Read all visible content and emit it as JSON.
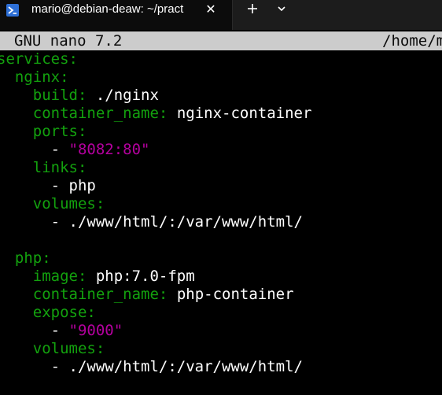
{
  "tab": {
    "title": "mario@debian-deaw: ~/pract",
    "close_label": "✕",
    "new_tab_label": "+",
    "dropdown_label": "⌄"
  },
  "nano": {
    "version": "GNU nano 7.2",
    "path": "/home/m"
  },
  "editor": {
    "lines": [
      {
        "indent": "",
        "key": "services",
        "colon": ":",
        "value": "",
        "value_type": "plain"
      },
      {
        "indent": "  ",
        "key": "nginx",
        "colon": ":",
        "value": "",
        "value_type": "plain"
      },
      {
        "indent": "    ",
        "key": "build",
        "colon": ":",
        "value": " ./nginx",
        "value_type": "plain"
      },
      {
        "indent": "    ",
        "key": "container_name",
        "colon": ":",
        "value": " nginx-container",
        "value_type": "plain"
      },
      {
        "indent": "    ",
        "key": "ports",
        "colon": ":",
        "value": "",
        "value_type": "plain"
      },
      {
        "indent": "      ",
        "key": "",
        "colon": "",
        "dash": "- ",
        "value": "\"8082:80\"",
        "value_type": "string"
      },
      {
        "indent": "    ",
        "key": "links",
        "colon": ":",
        "value": "",
        "value_type": "plain"
      },
      {
        "indent": "      ",
        "key": "",
        "colon": "",
        "dash": "- ",
        "value": "php",
        "value_type": "plain"
      },
      {
        "indent": "    ",
        "key": "volumes",
        "colon": ":",
        "value": "",
        "value_type": "plain"
      },
      {
        "indent": "      ",
        "key": "",
        "colon": "",
        "dash": "- ",
        "value": "./www/html/:/var/www/html/",
        "value_type": "plain"
      },
      {
        "indent": "",
        "key": "",
        "colon": "",
        "value": "",
        "value_type": "plain"
      },
      {
        "indent": "  ",
        "key": "php",
        "colon": ":",
        "value": "",
        "value_type": "plain"
      },
      {
        "indent": "    ",
        "key": "image",
        "colon": ":",
        "value": " php:7.0-fpm",
        "value_type": "plain"
      },
      {
        "indent": "    ",
        "key": "container_name",
        "colon": ":",
        "value": " php-container",
        "value_type": "plain"
      },
      {
        "indent": "    ",
        "key": "expose",
        "colon": ":",
        "value": "",
        "value_type": "plain"
      },
      {
        "indent": "      ",
        "key": "",
        "colon": "",
        "dash": "- ",
        "value": "\"9000\"",
        "value_type": "string"
      },
      {
        "indent": "    ",
        "key": "volumes",
        "colon": ":",
        "value": "",
        "value_type": "plain"
      },
      {
        "indent": "      ",
        "key": "",
        "colon": "",
        "dash": "- ",
        "value": "./www/html/:/var/www/html/",
        "value_type": "plain"
      }
    ]
  },
  "colors": {
    "key": "#13a10e",
    "string": "#b4009e",
    "text": "#ffffff",
    "header_bg": "#cccccc",
    "background": "#000000"
  }
}
